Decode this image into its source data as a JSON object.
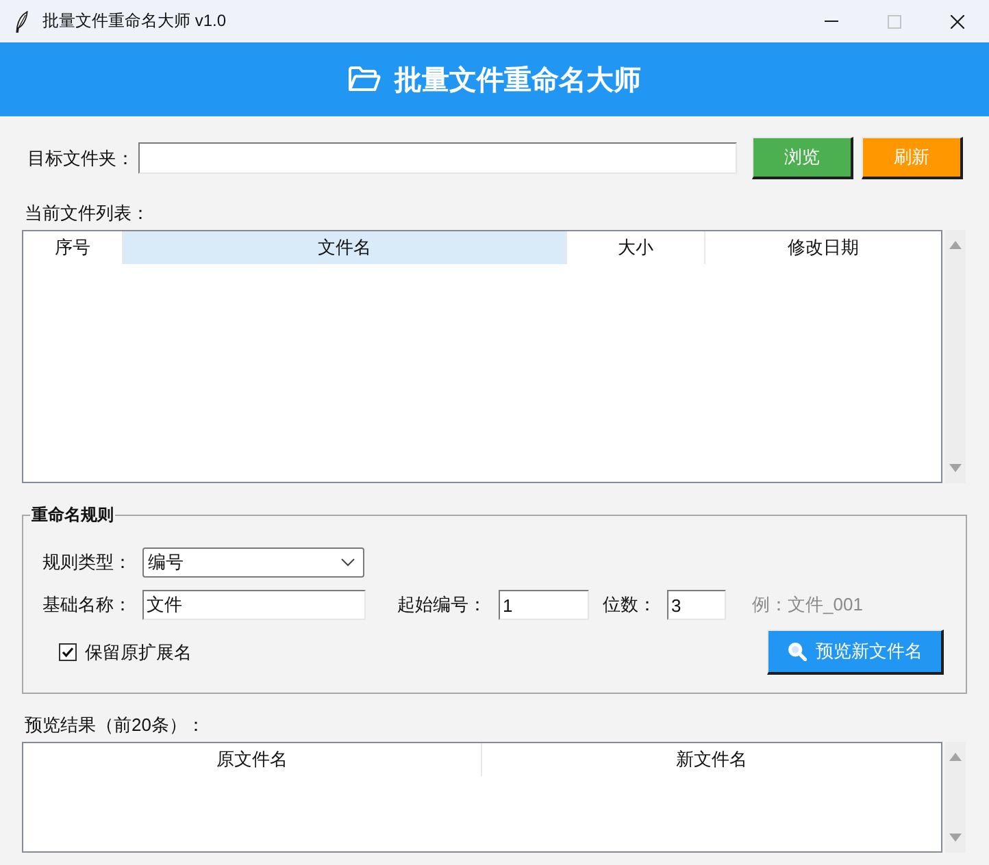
{
  "window": {
    "title": "批量文件重命名大师 v1.0",
    "controls": [
      {
        "kind": "minimize",
        "disabled": false
      },
      {
        "kind": "maximize",
        "disabled": true
      },
      {
        "kind": "close",
        "disabled": false
      }
    ]
  },
  "header": {
    "title": "批量文件重命名大师"
  },
  "folder_row": {
    "label": "目标文件夹：",
    "buttons": [
      {
        "label": "浏览",
        "kind": "browse"
      },
      {
        "label": "刷新",
        "kind": "refresh"
      }
    ]
  },
  "file_list": {
    "label": "当前文件列表：",
    "columns": [
      {
        "label": "序号",
        "selected": false
      },
      {
        "label": "文件名",
        "selected": true
      },
      {
        "label": "大小",
        "selected": false
      },
      {
        "label": "修改日期",
        "selected": false
      }
    ]
  },
  "rename_rules": {
    "title": "重命名规则",
    "rule_type": {
      "label": "规则类型：",
      "value": "编号"
    },
    "base_name": {
      "label": "基础名称：",
      "value": "文件"
    },
    "start_number": {
      "label": "起始编号：",
      "value": "1"
    },
    "digits": {
      "label": "位数：",
      "value": "3"
    },
    "example": "例：文件_001",
    "keep_extension": {
      "label": "保留原扩展名",
      "checked": true
    },
    "preview_button": {
      "label": "预览新文件名"
    }
  },
  "preview": {
    "label": "预览结果（前20条）：",
    "columns": [
      "原文件名",
      "新文件名"
    ]
  }
}
